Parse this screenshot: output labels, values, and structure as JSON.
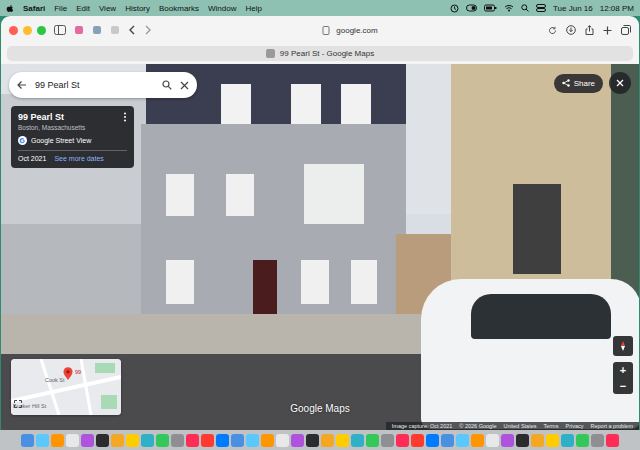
{
  "menubar": {
    "app": "Safari",
    "items": [
      "File",
      "Edit",
      "View",
      "History",
      "Bookmarks",
      "Window",
      "Help"
    ],
    "date": "Tue Jun 16",
    "time": "12:08 PM"
  },
  "browser": {
    "address": "google.com",
    "tabs": [
      {
        "label": "99 Pearl St - Google Maps",
        "selected": true
      }
    ]
  },
  "search": {
    "value": "99 Pearl St"
  },
  "info_card": {
    "title": "99 Pearl St",
    "subtitle": "Boston, Massachusetts",
    "source": "Google Street View",
    "date": "Oct 2021",
    "more": "See more dates"
  },
  "share": "Share",
  "zoom": [
    "+",
    "−"
  ],
  "minimap": {
    "labels": [
      "Bunker Hill St",
      "Cook St"
    ],
    "pin": "99"
  },
  "watermark": "Google Maps",
  "footer": [
    "Image capture: Oct 2021",
    "© 2026 Google",
    "United States",
    "Terms",
    "Privacy",
    "Report a problem"
  ]
}
